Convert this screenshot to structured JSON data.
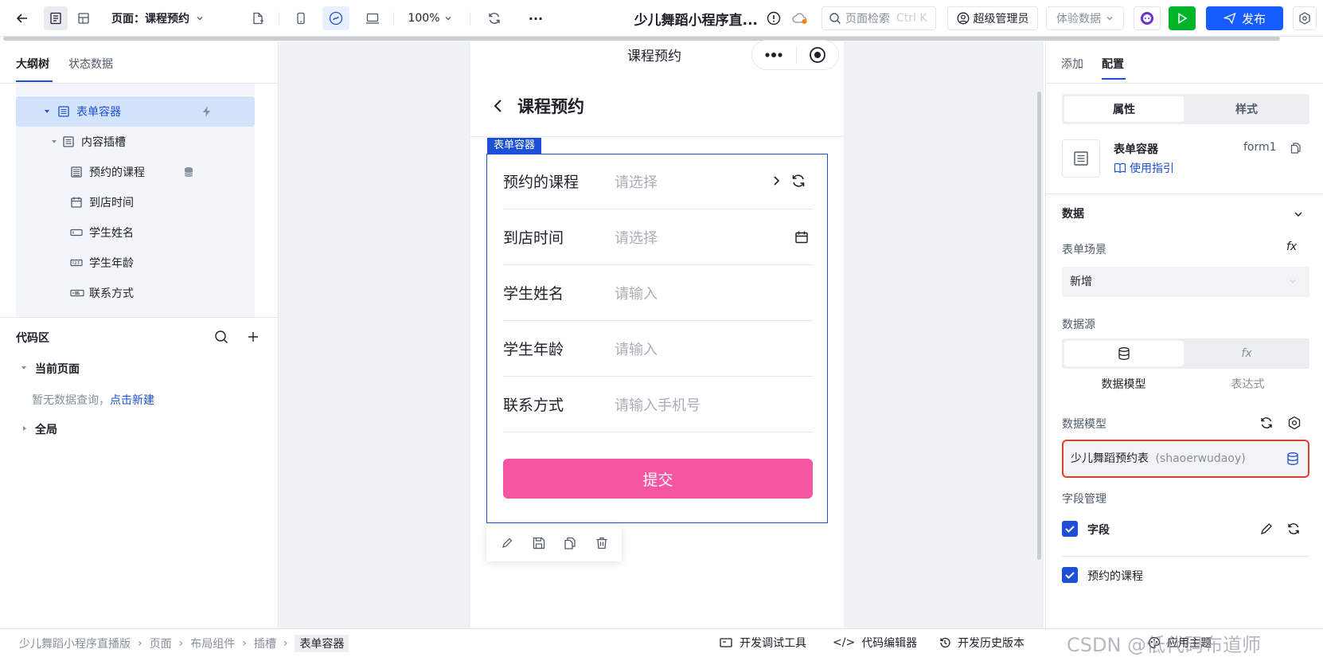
{
  "toolbar": {
    "page_label": "页面：课程预约",
    "zoom": "100%",
    "more": "···",
    "app_title": "少儿舞蹈小程序直...",
    "search_placeholder": "页面检索",
    "search_shortcut": "Ctrl K",
    "user_role": "超级管理员",
    "data_mode": "体验数据",
    "publish_label": "发布"
  },
  "left": {
    "tabs": [
      "大纲树",
      "状态数据"
    ],
    "tree": [
      {
        "label": "表单容器"
      },
      {
        "label": "内容插槽"
      },
      {
        "label": "预约的课程"
      },
      {
        "label": "到店时间"
      },
      {
        "label": "学生姓名"
      },
      {
        "label": "学生年龄"
      },
      {
        "label": "联系方式"
      }
    ],
    "code_title": "代码区",
    "current_page": "当前页面",
    "empty_text": "暂无数据查询，",
    "create_link": "点击新建",
    "global": "全局"
  },
  "phone": {
    "header_title": "课程预约",
    "page_title": "课程预约",
    "container_tag": "表单容器",
    "fields": [
      {
        "label": "预约的课程",
        "placeholder": "请选择"
      },
      {
        "label": "到店时间",
        "placeholder": "请选择"
      },
      {
        "label": "学生姓名",
        "placeholder": "请输入"
      },
      {
        "label": "学生年龄",
        "placeholder": "请输入"
      },
      {
        "label": "联系方式",
        "placeholder": "请输入手机号"
      }
    ],
    "submit": "提交"
  },
  "right": {
    "tabs": [
      "添加",
      "配置"
    ],
    "seg": [
      "属性",
      "样式"
    ],
    "comp_name": "表单容器",
    "comp_id": "form1",
    "guide": "使用指引",
    "section_data": "数据",
    "scene_label": "表单场景",
    "scene_value": "新增",
    "fx": "fx",
    "source_label": "数据源",
    "source_opts": [
      "数据模型",
      "表达式"
    ],
    "model_label": "数据模型",
    "model_value": "少儿舞蹈预约表",
    "model_id": "(shaoerwudaoy)",
    "field_mgmt": "字段管理",
    "field_group": "字段",
    "field_item": "预约的课程"
  },
  "status": {
    "breadcrumb": [
      "少儿舞蹈小程序直播版",
      "页面",
      "布局组件",
      "插槽",
      "表单容器"
    ],
    "devtools": "开发调试工具",
    "code_editor": "代码编辑器",
    "history": "开发历史版本",
    "theme": "应用主题",
    "watermark": "CSDN @低代码布道师"
  },
  "colors": {
    "primary": "#1d50d6",
    "publish": "#165dff",
    "run": "#00b42a",
    "submit": "#f556a4",
    "highlight": "#e03e2d"
  }
}
